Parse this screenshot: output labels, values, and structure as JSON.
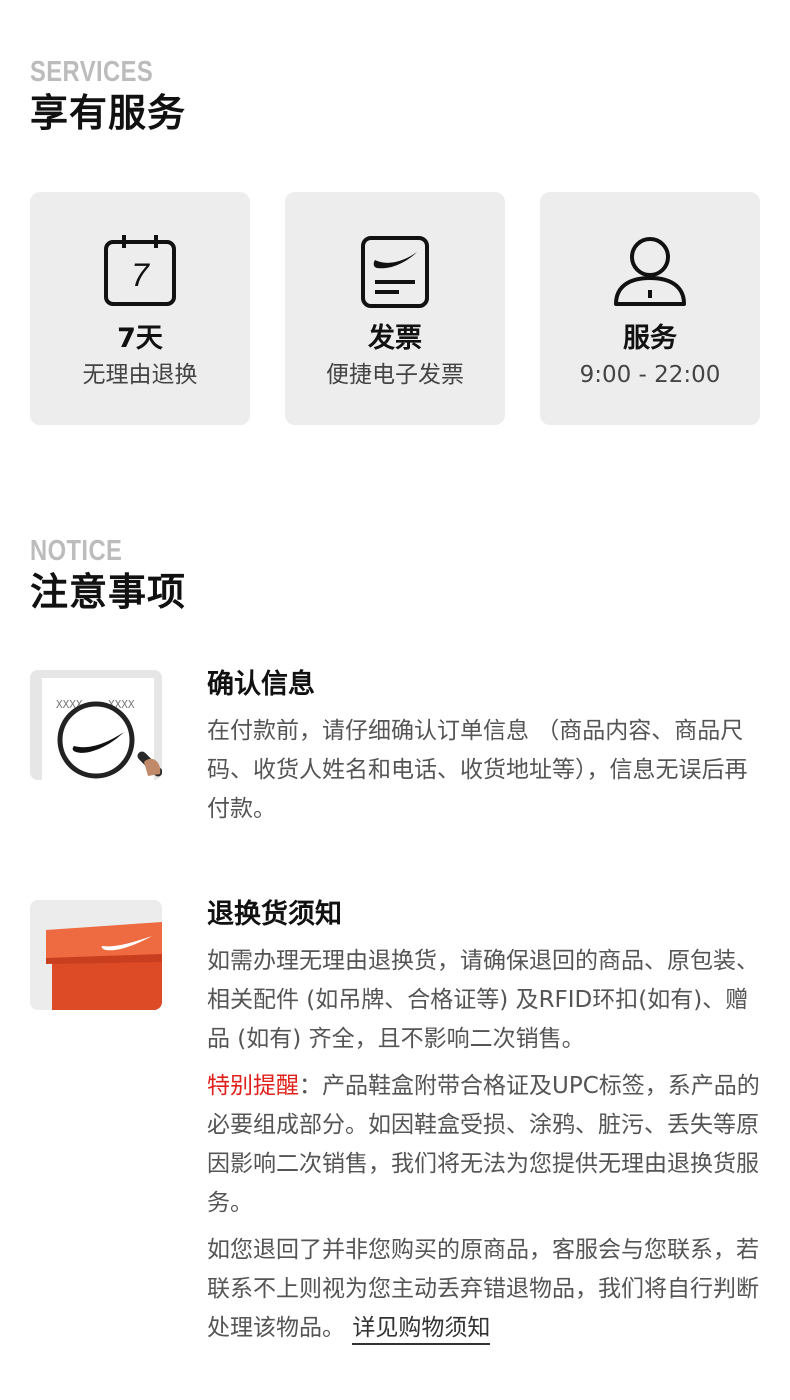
{
  "services": {
    "eyebrow": "SERVICES",
    "title": "享有服务",
    "items": [
      {
        "icon": "calendar-icon",
        "icon_text": "7",
        "title": "7天",
        "subtitle": "无理由退换"
      },
      {
        "icon": "invoice-icon",
        "title": "发票",
        "subtitle": "便捷电子发票"
      },
      {
        "icon": "customer-service-icon",
        "title": "服务",
        "subtitle": "9:00 - 22:00"
      }
    ]
  },
  "notice": {
    "eyebrow": "NOTICE",
    "title": "注意事项",
    "items": [
      {
        "image": "magnifier-receipt-image",
        "title": "确认信息",
        "body": "在付款前，请仔细确认订单信息 （商品内容、商品尺码、收货人姓名和电话、收货地址等），信息无误后再付款。"
      },
      {
        "image": "shoebox-image",
        "title": "退换货须知",
        "body": "如需办理无理由退换货，请确保退回的商品、原包装、相关配件 (如吊牌、合格证等) 及RFID环扣(如有)、赠品 (如有) 齐全，且不影响二次销售。",
        "reminder_label": "特别提醒",
        "reminder_text": "：产品鞋盒附带合格证及UPC标签，系产品的必要组成部分。如因鞋盒受损、涂鸦、脏污、丢失等原因影响二次销售，我们将无法为您提供无理由退换货服务。",
        "extra_text": "如您退回了并非您购买的原商品，客服会与您联系，若联系不上则视为您主动丢弃错退物品，我们将自行判断处理该物品。",
        "link_text": "详见购物须知"
      }
    ],
    "receipt_text": "XXXX"
  },
  "colors": {
    "accent_red": "#e0201a",
    "card_bg": "#ededed",
    "eyebrow_gray": "#bcbcbc",
    "box_orange": "#e8542e"
  }
}
